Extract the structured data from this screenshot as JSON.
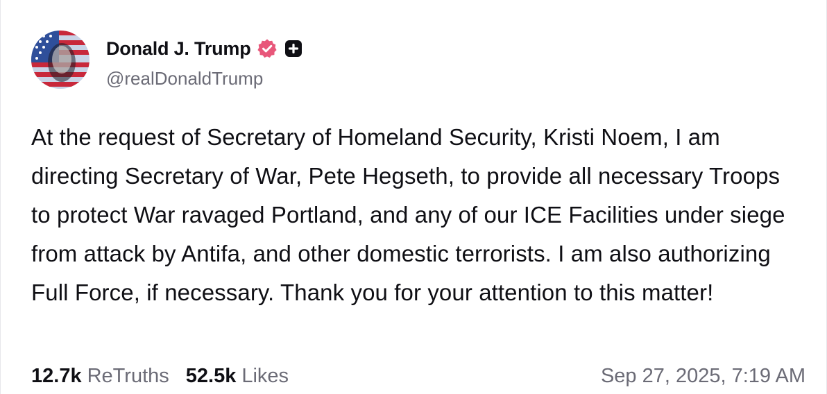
{
  "author": {
    "display_name": "Donald J. Trump",
    "handle": "@realDonaldTrump",
    "verified_icon": "verified-badge-icon",
    "plus_icon": "plus-badge-icon",
    "avatar_icon": "user-avatar"
  },
  "post": {
    "text": "At the request of Secretary of Homeland Security, Kristi Noem, I am directing Secretary of War, Pete Hegseth, to provide all necessary Troops to protect War ravaged Portland, and any of our ICE Facilities under siege from attack by Antifa, and other domestic terrorists. I am also authorizing Full Force, if necessary. Thank you for your attention to this matter!"
  },
  "stats": {
    "retruths_count": "12.7k",
    "retruths_label": "ReTruths",
    "likes_count": "52.5k",
    "likes_label": "Likes",
    "timestamp": "Sep 27, 2025, 7:19 AM"
  },
  "colors": {
    "verified_badge": "#e8577a",
    "text_primary": "#0f0f14",
    "text_secondary": "#6b6b76"
  }
}
